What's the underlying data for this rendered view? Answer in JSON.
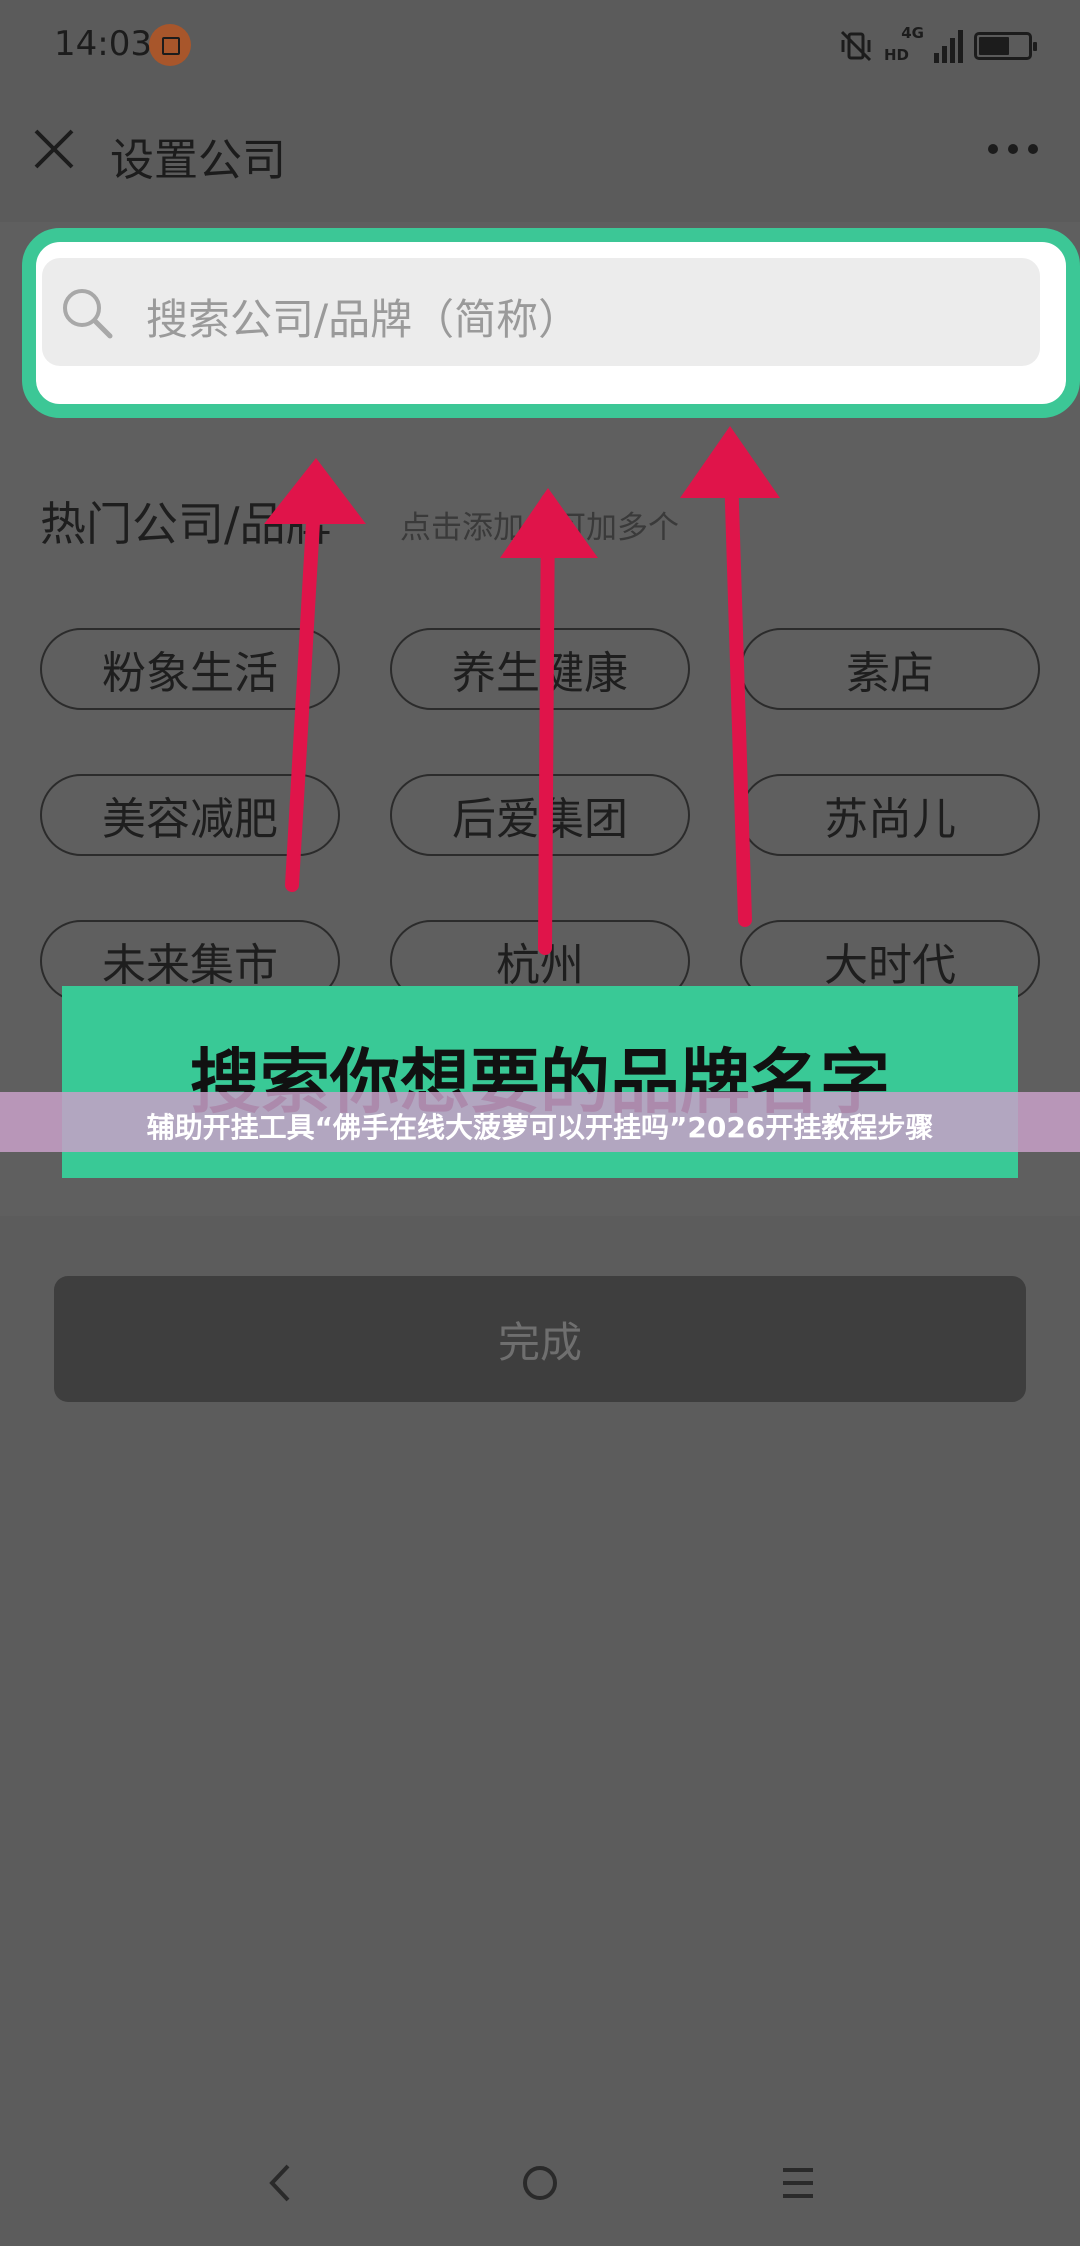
{
  "status_bar": {
    "time": "14:03",
    "network_type": "4G",
    "hd_label": "HD",
    "icons": [
      "record-icon",
      "vibrate-off-icon",
      "signal-icon",
      "battery-icon"
    ]
  },
  "header": {
    "title": "设置公司",
    "close_icon": "close-icon",
    "more_icon": "more-icon"
  },
  "search": {
    "placeholder": "搜索公司/品牌（简称）",
    "frame_color": "#3cc796"
  },
  "hot_section": {
    "title": "热门公司/品牌",
    "hint": "点击添加，可加多个"
  },
  "chips": [
    {
      "label": "粉象生活"
    },
    {
      "label": "养生健康"
    },
    {
      "label": "素店"
    },
    {
      "label": "美容减肥"
    },
    {
      "label": "后爱集团"
    },
    {
      "label": "苏尚儿"
    },
    {
      "label": "未来集市"
    },
    {
      "label": "杭州"
    },
    {
      "label": "大时代"
    }
  ],
  "annotation": {
    "text": "搜索你想要的品牌名字",
    "banner_color": "#39c996",
    "arrow_color": "#e0144a"
  },
  "overlay": {
    "text": "辅助开挂工具“佛手在线大菠萝可以开挂吗”2026开挂教程步骤"
  },
  "footer": {
    "done_label": "完成"
  },
  "nav_bar": {
    "icons": [
      "back-icon",
      "home-icon",
      "menu-icon"
    ]
  }
}
